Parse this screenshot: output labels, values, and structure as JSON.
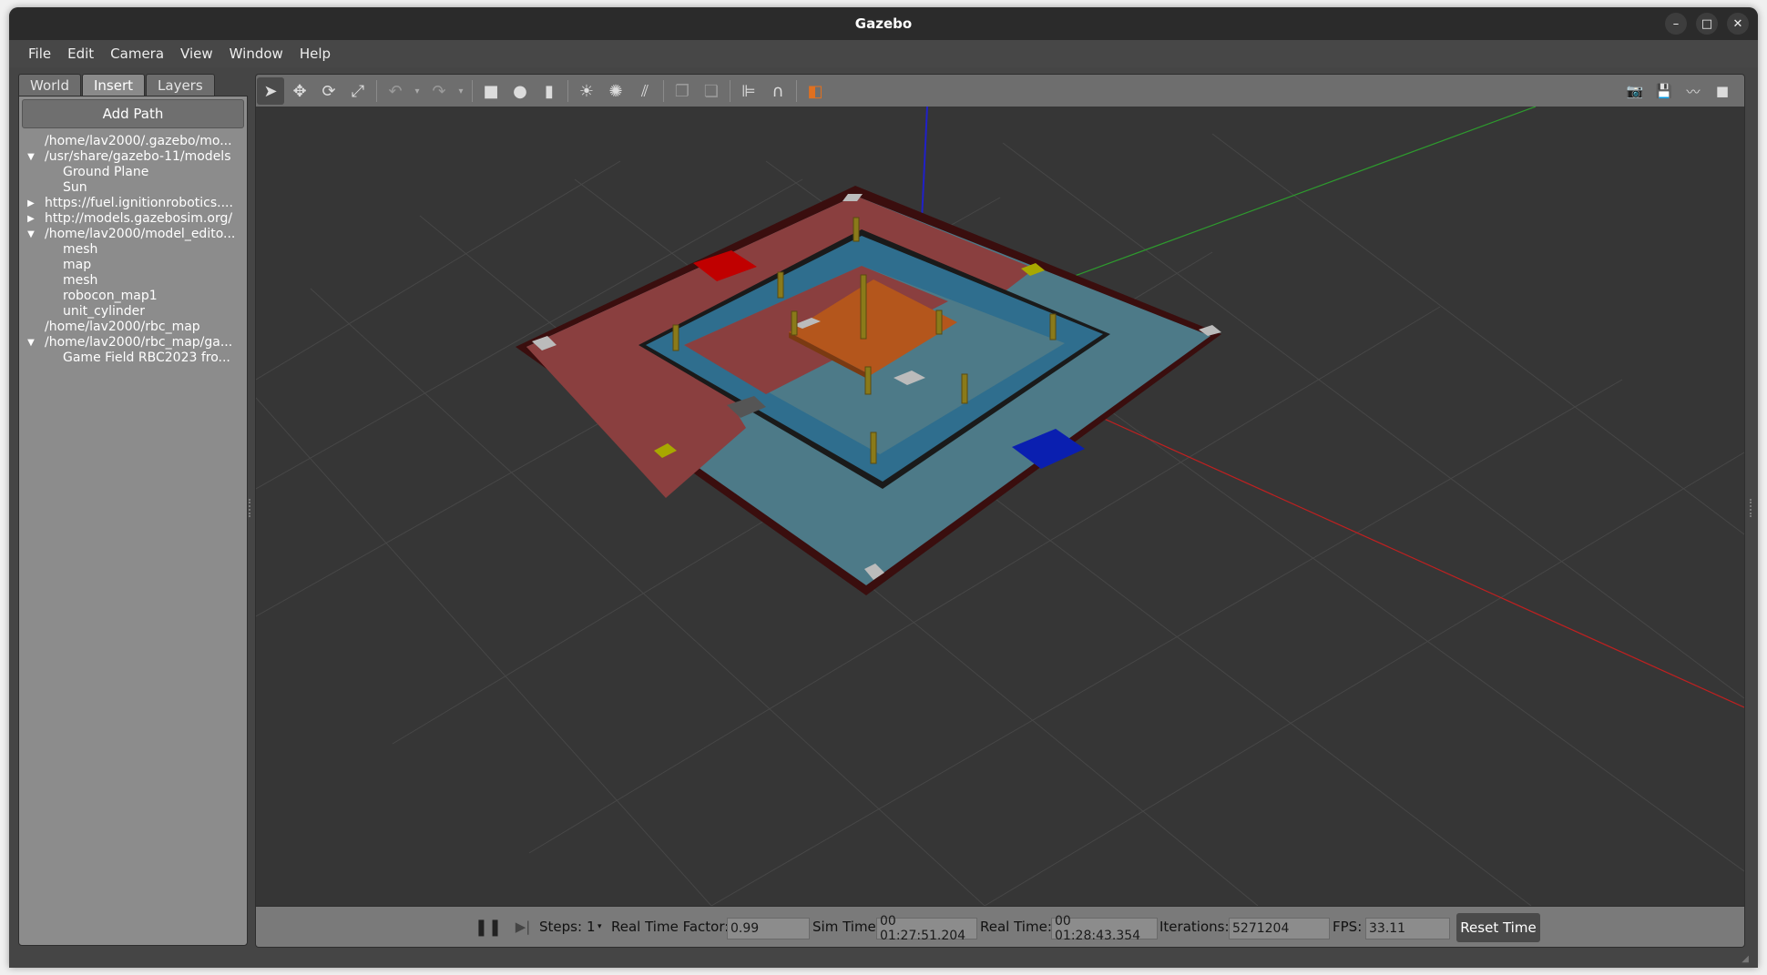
{
  "window": {
    "title": "Gazebo",
    "controls": [
      "–",
      "□",
      "✕"
    ]
  },
  "menu": [
    {
      "label": "File"
    },
    {
      "label": "Edit"
    },
    {
      "label": "Camera"
    },
    {
      "label": "View"
    },
    {
      "label": "Window"
    },
    {
      "label": "Help"
    }
  ],
  "left_panel": {
    "tabs": [
      {
        "label": "World",
        "active": false
      },
      {
        "label": "Insert",
        "active": true
      },
      {
        "label": "Layers",
        "active": false
      }
    ],
    "add_path_label": "Add Path",
    "tree": [
      {
        "label": "/home/lav2000/.gazebo/mo...",
        "arrow": "",
        "child": false
      },
      {
        "label": "/usr/share/gazebo-11/models",
        "arrow": "down",
        "child": false
      },
      {
        "label": "Ground Plane",
        "arrow": "",
        "child": true
      },
      {
        "label": "Sun",
        "arrow": "",
        "child": true
      },
      {
        "label": "https://fuel.ignitionrobotics....",
        "arrow": "right",
        "child": false
      },
      {
        "label": "http://models.gazebosim.org/",
        "arrow": "right",
        "child": false
      },
      {
        "label": "/home/lav2000/model_edito...",
        "arrow": "down",
        "child": false
      },
      {
        "label": "mesh",
        "arrow": "",
        "child": true
      },
      {
        "label": "map",
        "arrow": "",
        "child": true
      },
      {
        "label": "mesh",
        "arrow": "",
        "child": true
      },
      {
        "label": "robocon_map1",
        "arrow": "",
        "child": true
      },
      {
        "label": "unit_cylinder",
        "arrow": "",
        "child": true
      },
      {
        "label": "/home/lav2000/rbc_map",
        "arrow": "",
        "child": false
      },
      {
        "label": "/home/lav2000/rbc_map/ga...",
        "arrow": "down",
        "child": false
      },
      {
        "label": "Game Field RBC2023 fro...",
        "arrow": "",
        "child": true
      }
    ]
  },
  "toolbar": {
    "tools": [
      {
        "name": "select-tool",
        "glyph": "➤",
        "active": true
      },
      {
        "name": "translate-tool",
        "glyph": "✥"
      },
      {
        "name": "rotate-tool",
        "glyph": "⟳"
      },
      {
        "name": "scale-tool",
        "glyph": "⤢"
      },
      {
        "name": "undo-tool",
        "glyph": "↶",
        "dim": true
      },
      {
        "name": "redo-tool",
        "glyph": "↷",
        "dim": true
      },
      {
        "name": "box-shape-tool",
        "glyph": "■"
      },
      {
        "name": "sphere-shape-tool",
        "glyph": "●"
      },
      {
        "name": "cylinder-shape-tool",
        "glyph": "▮"
      },
      {
        "name": "point-light-tool",
        "glyph": "☀"
      },
      {
        "name": "spot-light-tool",
        "glyph": "✺"
      },
      {
        "name": "directional-light-tool",
        "glyph": "⫽"
      },
      {
        "name": "copy-tool",
        "glyph": "❐",
        "dim": true
      },
      {
        "name": "paste-tool",
        "glyph": "❏",
        "dim": true
      },
      {
        "name": "align-tool",
        "glyph": "⊫"
      },
      {
        "name": "snap-tool",
        "glyph": "∩"
      },
      {
        "name": "view-angle-tool",
        "glyph": "◧"
      }
    ],
    "right_tools": [
      {
        "name": "screenshot-tool",
        "glyph": "📷"
      },
      {
        "name": "log-tool",
        "glyph": "💾"
      },
      {
        "name": "plot-tool",
        "glyph": "〰"
      },
      {
        "name": "video-record-tool",
        "glyph": "■"
      }
    ]
  },
  "status": {
    "steps_label": "Steps:",
    "steps_value": "1",
    "rtf_label": "Real Time Factor:",
    "rtf_value": "0.99",
    "sim_time_label": "Sim Time:",
    "sim_time_value": "00 01:27:51.204",
    "real_time_label": "Real Time:",
    "real_time_value": "00 01:28:43.354",
    "iterations_label": "Iterations:",
    "iterations_value": "5271204",
    "fps_label": "FPS:",
    "fps_value": "33.11",
    "reset_label": "Reset Time"
  },
  "colors": {
    "field_red": "#8a3f3f",
    "field_blue": "#4d7a88",
    "field_blue_dark": "#2f6e8e",
    "border_dark": "#3a0e0e",
    "center_orange": "#b4561c",
    "red_zone": "#c00000",
    "blue_zone": "#0a1fb0",
    "yellow_marker": "#a8a800",
    "axis_x": "#c02020",
    "axis_y": "#2e9a2e",
    "axis_z": "#2020c8"
  }
}
